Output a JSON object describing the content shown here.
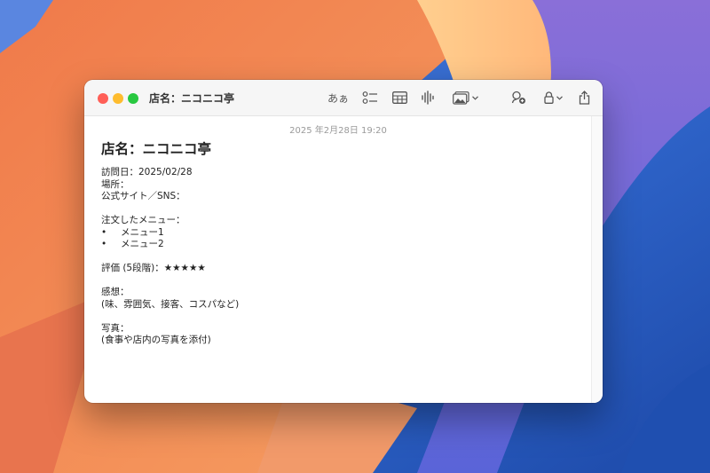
{
  "window": {
    "title": "店名：ニコニコ亭",
    "toolbar": {
      "text_format_label": "あぁ",
      "icons": [
        "checklist-icon",
        "table-icon",
        "audio-waveform-icon",
        "media-icon",
        "collaborate-icon",
        "lock-icon",
        "share-icon"
      ]
    }
  },
  "note": {
    "timestamp": "2025 年2月28日 19:20",
    "title": "店名：ニコニコ亭",
    "visit_date": "訪問日：2025/02/28",
    "place": "場所：",
    "official_site": "公式サイト／SNS：",
    "menu_heading": "注文したメニュー：",
    "menu_items": [
      "メニュー1",
      "メニュー2"
    ],
    "bullet": "•",
    "rating": "評価 (5段階)：★★★★★",
    "impression_heading": "感想：",
    "impression_hint": "(味、雰囲気、接客、コスパなど)",
    "photo_heading": "写真：",
    "photo_hint": "(食事や店内の写真を添付)"
  },
  "colors": {
    "close": "#ff5f57",
    "minimize": "#febc2e",
    "zoom": "#28c840"
  }
}
